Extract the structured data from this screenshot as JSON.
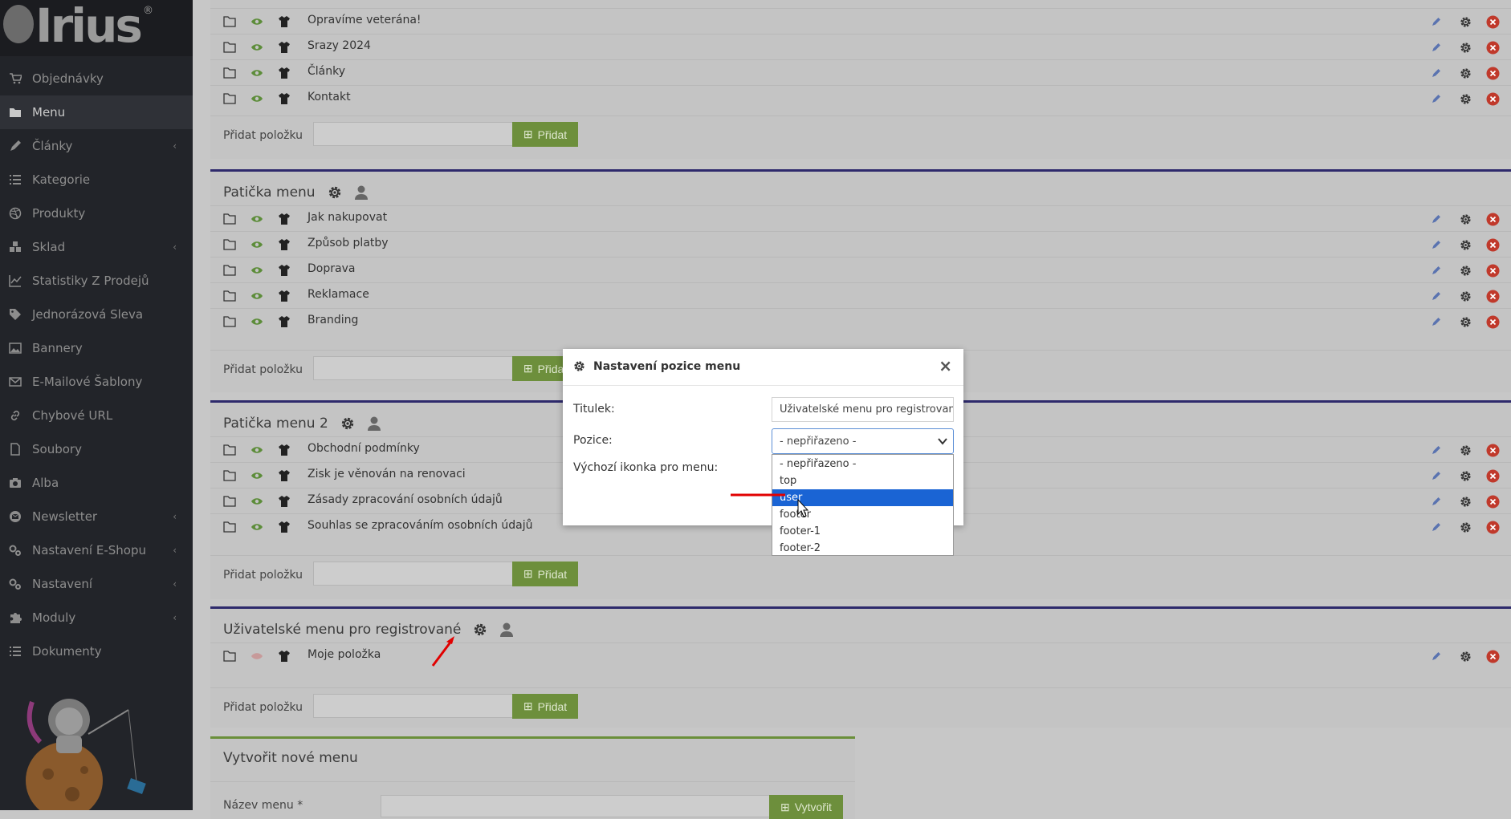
{
  "brand": {
    "logo_text": "Irius",
    "registered_mark": "®"
  },
  "sidebar": {
    "items": [
      {
        "label": "Objednávky",
        "icon": "cart-icon",
        "chevron": false,
        "active": false
      },
      {
        "label": "Menu",
        "icon": "folder-icon",
        "chevron": false,
        "active": true
      },
      {
        "label": "Články",
        "icon": "pencil-icon",
        "chevron": true,
        "active": false
      },
      {
        "label": "Kategorie",
        "icon": "list-icon",
        "chevron": false,
        "active": false
      },
      {
        "label": "Produkty",
        "icon": "dribbble-icon",
        "chevron": false,
        "active": false
      },
      {
        "label": "Sklad",
        "icon": "boxes-icon",
        "chevron": true,
        "active": false
      },
      {
        "label": "Statistiky Z Prodejů",
        "icon": "chart-icon",
        "chevron": false,
        "active": false
      },
      {
        "label": "Jednorázová Sleva",
        "icon": "tag-icon",
        "chevron": false,
        "active": false
      },
      {
        "label": "Bannery",
        "icon": "image-icon",
        "chevron": false,
        "active": false
      },
      {
        "label": "E-Mailové Šablony",
        "icon": "envelope-icon",
        "chevron": false,
        "active": false
      },
      {
        "label": "Chybové URL",
        "icon": "link-icon",
        "chevron": false,
        "active": false
      },
      {
        "label": "Soubory",
        "icon": "file-icon",
        "chevron": false,
        "active": false
      },
      {
        "label": "Alba",
        "icon": "camera-icon",
        "chevron": false,
        "active": false
      },
      {
        "label": "Newsletter",
        "icon": "mail-circle-icon",
        "chevron": true,
        "active": false
      },
      {
        "label": "Nastavení E-Shopu",
        "icon": "cogs-icon",
        "chevron": true,
        "active": false
      },
      {
        "label": "Nastavení",
        "icon": "cogs-icon",
        "chevron": true,
        "active": false
      },
      {
        "label": "Moduly",
        "icon": "puzzle-icon",
        "chevron": true,
        "active": false
      },
      {
        "label": "Dokumenty",
        "icon": "list-icon",
        "chevron": false,
        "active": false
      }
    ]
  },
  "menus": [
    {
      "title": "",
      "items": [
        "Opravíme veteránа!",
        "Srazy 2024",
        "Články",
        "Kontakt"
      ],
      "add_label": "Přidat položku",
      "add_button": "Přidat"
    },
    {
      "title": "Patička menu",
      "items": [
        "Jak nakupovat",
        "Způsob platby",
        "Doprava",
        "Reklamace",
        "Branding"
      ],
      "add_label": "Přidat položku",
      "add_button": "Přidat"
    },
    {
      "title": "Patička menu 2",
      "items": [
        "Obchodní podmínky",
        "Zisk je věnován na renovaci",
        "Zásady zpracování osobních údajů",
        "Souhlas se zpracováním osobních údajů"
      ],
      "add_label": "Přidat položku",
      "add_button": "Přidat"
    },
    {
      "title": "Uživatelské menu pro registrované",
      "items": [
        "Moje položka"
      ],
      "add_label": "Přidat položku",
      "add_button": "Přidat"
    }
  ],
  "create_menu": {
    "title": "Vytvořit nové menu",
    "name_label": "Název menu *",
    "button": "Vytvořit"
  },
  "modal": {
    "title": "Nastavení pozice menu",
    "close": "×",
    "titulek_label": "Titulek:",
    "titulek_value": "Uživatelské menu pro registrované",
    "pozice_label": "Pozice:",
    "pozice_value": "- nepřiřazeno -",
    "ikonka_label": "Výchozí ikonka pro menu:",
    "options": [
      "- nepřiřazeno -",
      "top",
      "user",
      "footer",
      "footer-1",
      "footer-2"
    ],
    "highlighted_option": "user"
  },
  "colors": {
    "sidebar_bg": "#222429",
    "panel_border": "#2e2a6c",
    "add_button": "#6d8f3c",
    "delete_icon": "#c0392b",
    "highlight": "#1a64d4",
    "annotation_arrow": "#e10000"
  }
}
